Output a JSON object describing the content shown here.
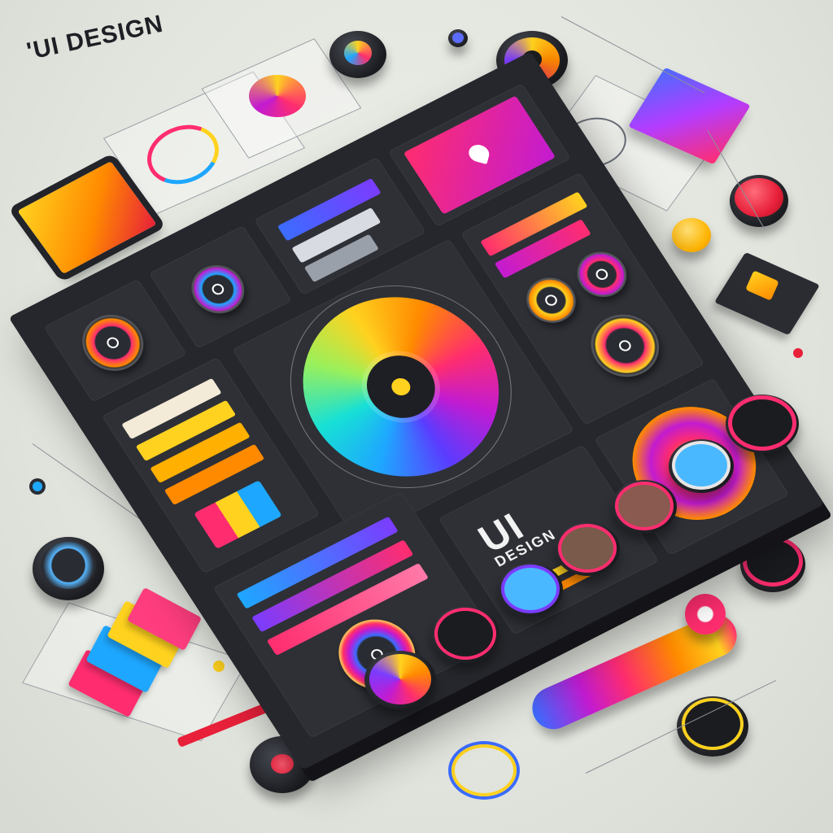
{
  "heading": {
    "text": "'UI DESIGN"
  },
  "board_label": {
    "line1": "UI",
    "line2": "DESIGN"
  },
  "colors": {
    "board": "#26272c",
    "pink": "#ff2d6f",
    "yellow": "#ffd21f",
    "orange": "#ff8a00",
    "blue": "#1ea7ff",
    "purple": "#7b3cff",
    "red": "#e8203a"
  },
  "icons": {
    "heart": "heart-icon",
    "lock": "lock-icon",
    "dial": "dial-icon"
  }
}
